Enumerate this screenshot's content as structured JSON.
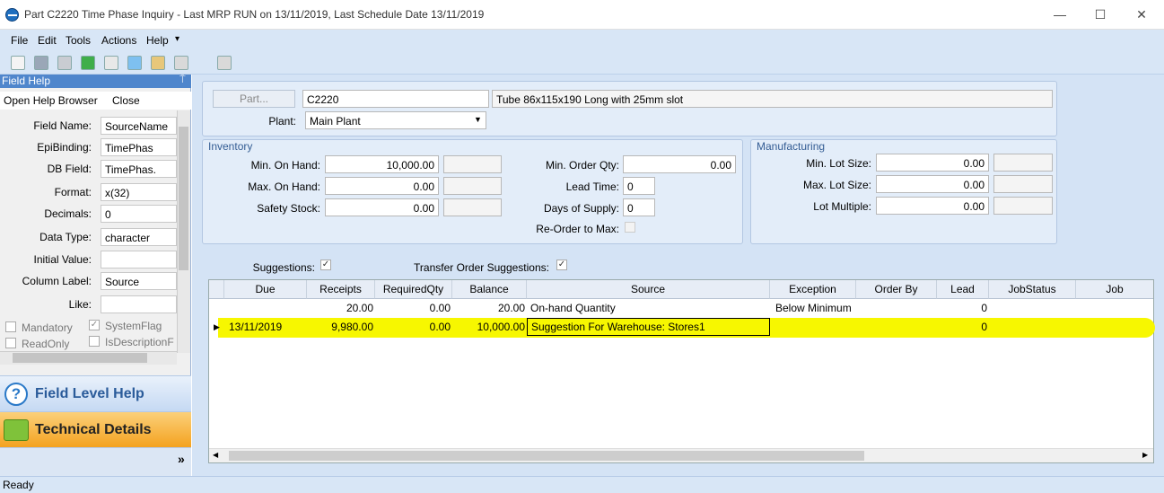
{
  "window": {
    "title": "Part C2220 Time Phase Inquiry  - Last MRP RUN on 13/11/2019, Last Schedule Date  13/11/2019",
    "minimize": "—",
    "maximize": "☐",
    "close": "✕"
  },
  "menu": [
    "File",
    "Edit",
    "Tools",
    "Actions",
    "Help"
  ],
  "menu_overflow": "▾",
  "field_help": {
    "title": "Field Help",
    "pin": "⍑",
    "open_browser": "Open Help Browser",
    "close": "Close",
    "fields": [
      {
        "label": "Field Name:",
        "value": "SourceName"
      },
      {
        "label": "EpiBinding:",
        "value": "TimePhas"
      },
      {
        "label": "DB Field:",
        "value": "TimePhas."
      },
      {
        "label": "Format:",
        "value": "x(32)"
      },
      {
        "label": "Decimals:",
        "value": "0"
      },
      {
        "label": "Data Type:",
        "value": "character"
      },
      {
        "label": "Initial Value:",
        "value": ""
      },
      {
        "label": "Column Label:",
        "value": "Source"
      },
      {
        "label": "Like:",
        "value": ""
      }
    ],
    "checks": {
      "mandatory": "Mandatory",
      "systemflag": "SystemFlag",
      "readonly": "ReadOnly",
      "isdescription": "IsDescriptionF"
    },
    "field_level_help": "Field Level Help",
    "technical_details": "Technical Details",
    "more": "»"
  },
  "part": {
    "button": "Part...",
    "number": "C2220",
    "description": "Tube 86x115x190 Long with 25mm slot",
    "plant_label": "Plant:",
    "plant_value": "Main Plant"
  },
  "inventory": {
    "title": "Inventory",
    "min_on_hand_label": "Min. On Hand:",
    "min_on_hand": "10,000.00",
    "max_on_hand_label": "Max. On Hand:",
    "max_on_hand": "0.00",
    "safety_stock_label": "Safety Stock:",
    "safety_stock": "0.00",
    "min_order_qty_label": "Min. Order Qty:",
    "min_order_qty": "0.00",
    "lead_time_label": "Lead Time:",
    "lead_time": "0",
    "days_supply_label": "Days of Supply:",
    "days_supply": "0",
    "reorder_label": "Re-Order to Max:"
  },
  "manufacturing": {
    "title": "Manufacturing",
    "min_lot_label": "Min. Lot Size:",
    "min_lot": "0.00",
    "max_lot_label": "Max. Lot Size:",
    "max_lot": "0.00",
    "lot_multiple_label": "Lot Multiple:",
    "lot_multiple": "0.00"
  },
  "suggestions": {
    "label": "Suggestions:",
    "transfer_label": "Transfer Order Suggestions:"
  },
  "grid": {
    "columns": [
      "Due",
      "Receipts",
      "RequiredQty",
      "Balance",
      "Source",
      "Exception",
      "Order By",
      "Lead",
      "JobStatus",
      "Job"
    ],
    "rows": [
      {
        "due": "",
        "receipts": "20.00",
        "required": "0.00",
        "balance": "20.00",
        "source": "On-hand Quantity",
        "exception": "Below Minimum",
        "orderby": "",
        "lead": "0"
      },
      {
        "due": "13/11/2019",
        "receipts": "9,980.00",
        "required": "0.00",
        "balance": "10,000.00",
        "source": "Suggestion For Warehouse: Stores1",
        "exception": "",
        "orderby": "",
        "lead": "0"
      }
    ]
  },
  "status": "Ready",
  "colors": {
    "highlight": "#ffff00",
    "accent": "#4f86cc"
  }
}
